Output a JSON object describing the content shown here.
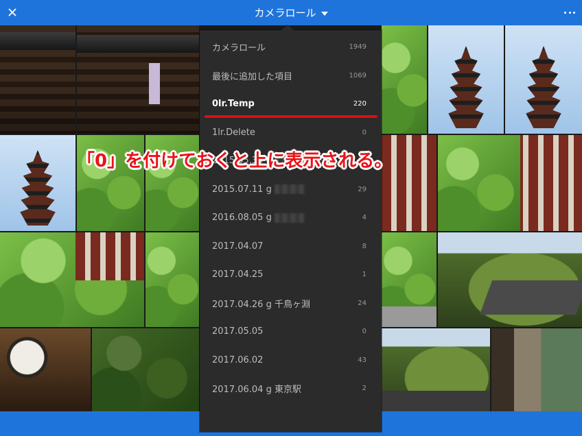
{
  "topbar": {
    "title": "カメラロール",
    "close_icon": "close-icon",
    "more_icon": "more-icon"
  },
  "menu": {
    "items": [
      {
        "label": "カメラロール",
        "count": "1949",
        "selected": false
      },
      {
        "label": "最後に追加した項目",
        "count": "1069",
        "selected": false
      },
      {
        "label": "0lr.Temp",
        "count": "220",
        "selected": true
      },
      {
        "label": "1lr.Delete",
        "count": "0",
        "selected": false
      },
      {
        "label": "2015.05.30 g",
        "count": "31",
        "selected": false,
        "blurred": true
      },
      {
        "label": "2015.07.11 g",
        "count": "29",
        "selected": false,
        "blurred": true
      },
      {
        "label": "2016.08.05 g",
        "count": "4",
        "selected": false,
        "blurred": true
      },
      {
        "label": "2017.04.07",
        "count": "8",
        "selected": false
      },
      {
        "label": "2017.04.25",
        "count": "1",
        "selected": false
      },
      {
        "label": "2017.04.26 g 千鳥ヶ淵",
        "count": "24",
        "selected": false
      },
      {
        "label": "2017.05.05",
        "count": "0",
        "selected": false
      },
      {
        "label": "2017.06.02",
        "count": "43",
        "selected": false
      },
      {
        "label": "2017.06.04 g 東京駅",
        "count": "2",
        "selected": false
      }
    ]
  },
  "annotation": {
    "text": "「0」を付けておくと上に表示される。",
    "color": "#e7141a"
  },
  "colors": {
    "accent": "#1f74dc",
    "menu_bg": "#2b2b2b",
    "highlight": "#e00c14"
  }
}
